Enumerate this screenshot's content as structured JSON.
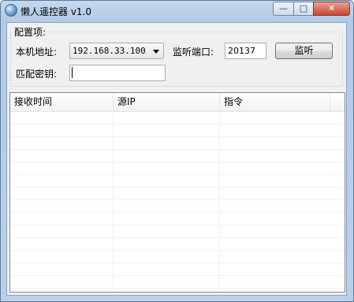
{
  "window": {
    "title": "懒人遥控器 v1.0",
    "controls": {
      "minimize": "—",
      "maximize": "□",
      "close": "✕"
    }
  },
  "config": {
    "group_label": "配置项:",
    "local_address_label": "本机地址:",
    "local_address_value": "192.168.33.100",
    "listen_port_label": "监听端口:",
    "listen_port_value": "20137",
    "listen_button": "监听",
    "key_label": "匹配密钥:",
    "key_value": ""
  },
  "table": {
    "columns": [
      "接收时间",
      "源IP",
      "指令"
    ],
    "rows": []
  }
}
